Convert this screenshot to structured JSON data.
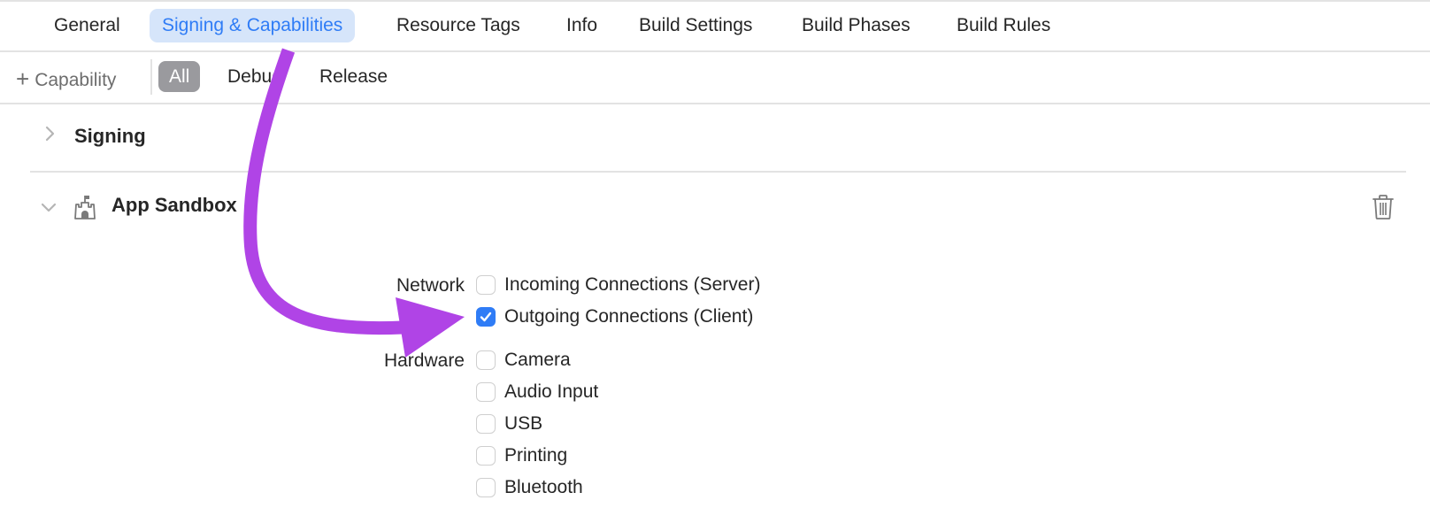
{
  "tabs": [
    {
      "label": "General",
      "active": false
    },
    {
      "label": "Signing & Capabilities",
      "active": true
    },
    {
      "label": "Resource Tags",
      "active": false
    },
    {
      "label": "Info",
      "active": false
    },
    {
      "label": "Build Settings",
      "active": false
    },
    {
      "label": "Build Phases",
      "active": false
    },
    {
      "label": "Build Rules",
      "active": false
    }
  ],
  "filterbar": {
    "add_capability_icon": "plus-icon",
    "add_capability_label": "Capability",
    "segments": [
      {
        "label": "All",
        "active": true
      },
      {
        "label": "Debug",
        "active": false
      },
      {
        "label": "Release",
        "active": false
      }
    ]
  },
  "sections": {
    "signing": {
      "title": "Signing",
      "expanded": false,
      "icon": "chevron-right-icon"
    },
    "app_sandbox": {
      "title": "App Sandbox",
      "expanded": true,
      "icon": "castle-icon",
      "delete_icon": "trash-icon"
    }
  },
  "sandbox": {
    "network": {
      "label": "Network",
      "options": [
        {
          "label": "Incoming Connections (Server)",
          "checked": false
        },
        {
          "label": "Outgoing Connections (Client)",
          "checked": true
        }
      ]
    },
    "hardware": {
      "label": "Hardware",
      "options": [
        {
          "label": "Camera",
          "checked": false
        },
        {
          "label": "Audio Input",
          "checked": false
        },
        {
          "label": "USB",
          "checked": false
        },
        {
          "label": "Printing",
          "checked": false
        },
        {
          "label": "Bluetooth",
          "checked": false
        }
      ]
    }
  },
  "annotation": {
    "type": "curved-arrow",
    "color": "#b044e6",
    "from": "Signing & Capabilities tab",
    "to": "Outgoing Connections (Client) checkbox"
  },
  "colors": {
    "accent": "#2f7cf6",
    "active_tab_bg": "#d6e5fa",
    "segment_active_bg": "#9a9a9e",
    "divider": "#e3e3e3"
  }
}
